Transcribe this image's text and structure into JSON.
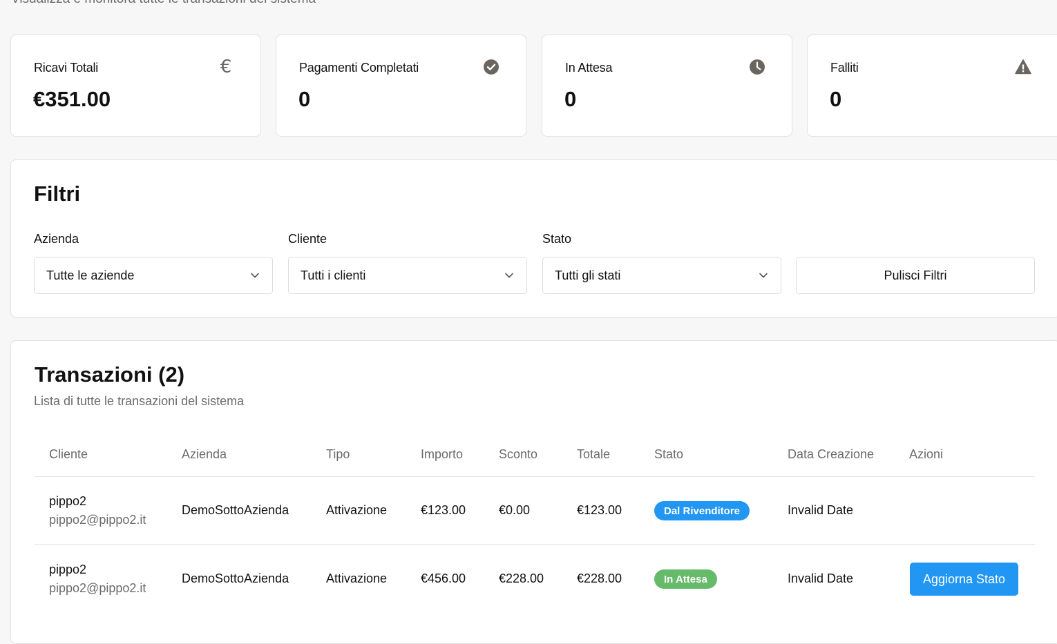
{
  "page": {
    "subtitle": "Visualizza e monitora tutte le transazioni del sistema"
  },
  "stats": [
    {
      "label": "Ricavi Totali",
      "value": "€351.00",
      "icon": "euro-icon",
      "icon_glyph": "€"
    },
    {
      "label": "Pagamenti Completati",
      "value": "0",
      "icon": "check-circle-icon"
    },
    {
      "label": "In Attesa",
      "value": "0",
      "icon": "clock-icon"
    },
    {
      "label": "Falliti",
      "value": "0",
      "icon": "warning-icon"
    }
  ],
  "filters": {
    "title": "Filtri",
    "azienda_label": "Azienda",
    "azienda_value": "Tutte le aziende",
    "cliente_label": "Cliente",
    "cliente_value": "Tutti i clienti",
    "stato_label": "Stato",
    "stato_value": "Tutti gli stati",
    "clear_label": "Pulisci Filtri"
  },
  "transactions": {
    "title": "Transazioni (2)",
    "description": "Lista di tutte le transazioni del sistema",
    "columns": [
      "Cliente",
      "Azienda",
      "Tipo",
      "Importo",
      "Sconto",
      "Totale",
      "Stato",
      "Data Creazione",
      "Azioni"
    ],
    "rows": [
      {
        "client_name": "pippo2",
        "client_email": "pippo2@pippo2.it",
        "company": "DemoSottoAzienda",
        "type": "Attivazione",
        "amount": "€123.00",
        "discount": "€0.00",
        "total": "€123.00",
        "status": "Dal Rivenditore",
        "status_color": "#2196f3",
        "created": "Invalid Date",
        "action": ""
      },
      {
        "client_name": "pippo2",
        "client_email": "pippo2@pippo2.it",
        "company": "DemoSottoAzienda",
        "type": "Attivazione",
        "amount": "€456.00",
        "discount": "€228.00",
        "total": "€228.00",
        "status": "In Attesa",
        "status_color": "#66bb6a",
        "created": "Invalid Date",
        "action": "Aggiorna Stato"
      }
    ]
  },
  "colors": {
    "primary": "#2196f3",
    "success": "#66bb6a",
    "icon_gray": "#6b6560"
  }
}
